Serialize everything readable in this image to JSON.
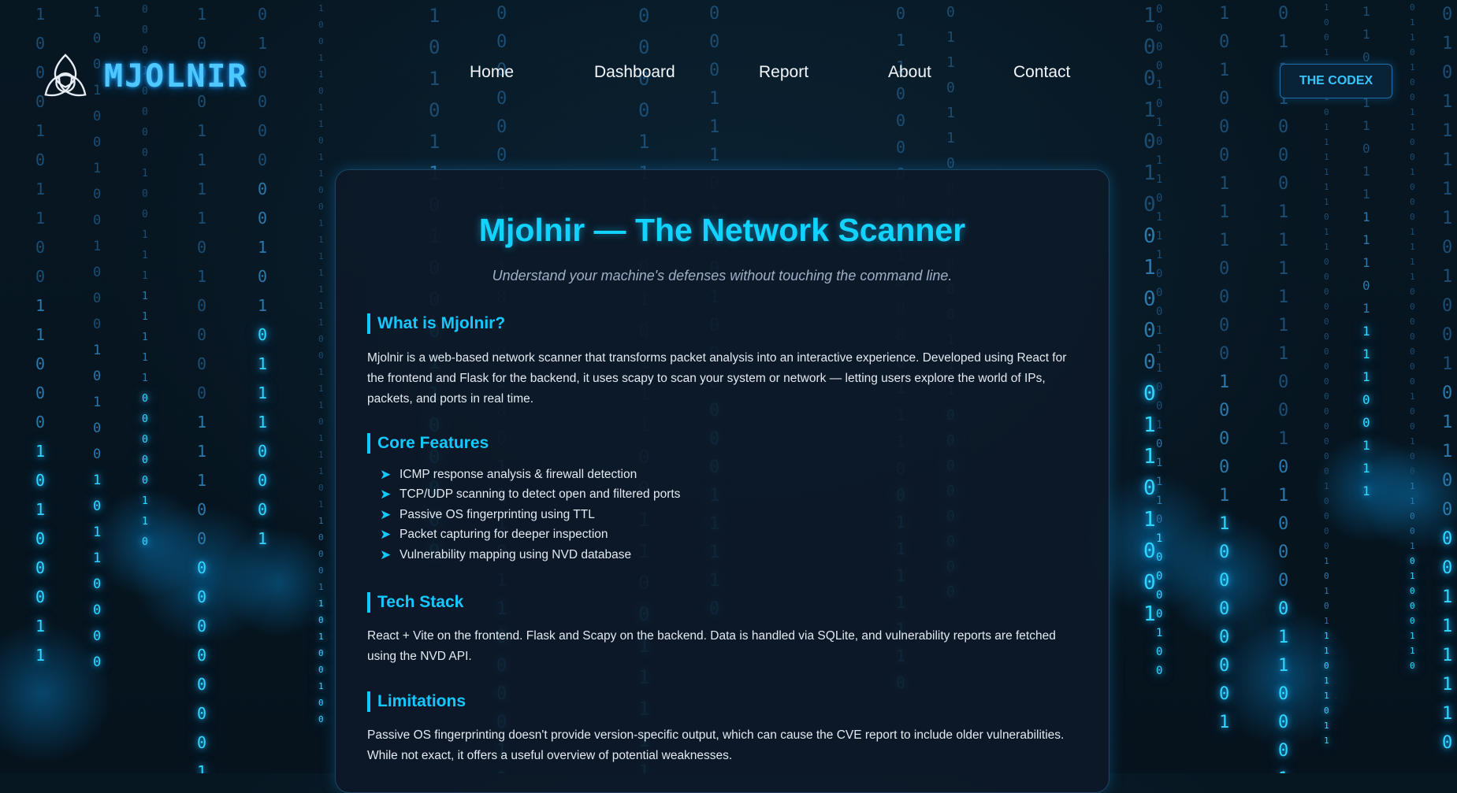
{
  "brand": {
    "name": "MJOLNIR"
  },
  "nav": {
    "items": [
      "Home",
      "Dashboard",
      "Report",
      "About",
      "Contact"
    ]
  },
  "codex_button": {
    "label": "THE CODEX"
  },
  "main": {
    "title": "Mjolnir — The Network Scanner",
    "subtitle": "Understand your machine's defenses without touching the command line.",
    "sections": [
      {
        "heading": "What is Mjolnir?",
        "body": "Mjolnir is a web-based network scanner that transforms packet analysis into an interactive experience. Developed using React for the frontend and Flask for the backend, it uses scapy to scan your system or network — letting users explore the world of IPs, packets, and ports in real time."
      },
      {
        "heading": "Core Features",
        "items": [
          "ICMP response analysis & firewall detection",
          "TCP/UDP scanning to detect open and filtered ports",
          "Passive OS fingerprinting using TTL",
          "Packet capturing for deeper inspection",
          "Vulnerability mapping using NVD database"
        ]
      },
      {
        "heading": "Tech Stack",
        "body": "React + Vite on the frontend. Flask and Scapy on the backend. Data is handled via SQLite, and vulnerability reports are fetched using the NVD API."
      },
      {
        "heading": "Limitations",
        "body": "Passive OS fingerprinting doesn't provide version-specific output, which can cause the CVE report to include older vulnerabilities. While not exact, it offers a useful overview of potential weaknesses."
      }
    ]
  },
  "colors": {
    "accent": "#12d3ff",
    "background": "#061420",
    "card": "#0d1928",
    "rain": "#1c4d72"
  },
  "icons": {
    "logo": "triquetra-icon",
    "bullet": "arrow-right-icon"
  }
}
